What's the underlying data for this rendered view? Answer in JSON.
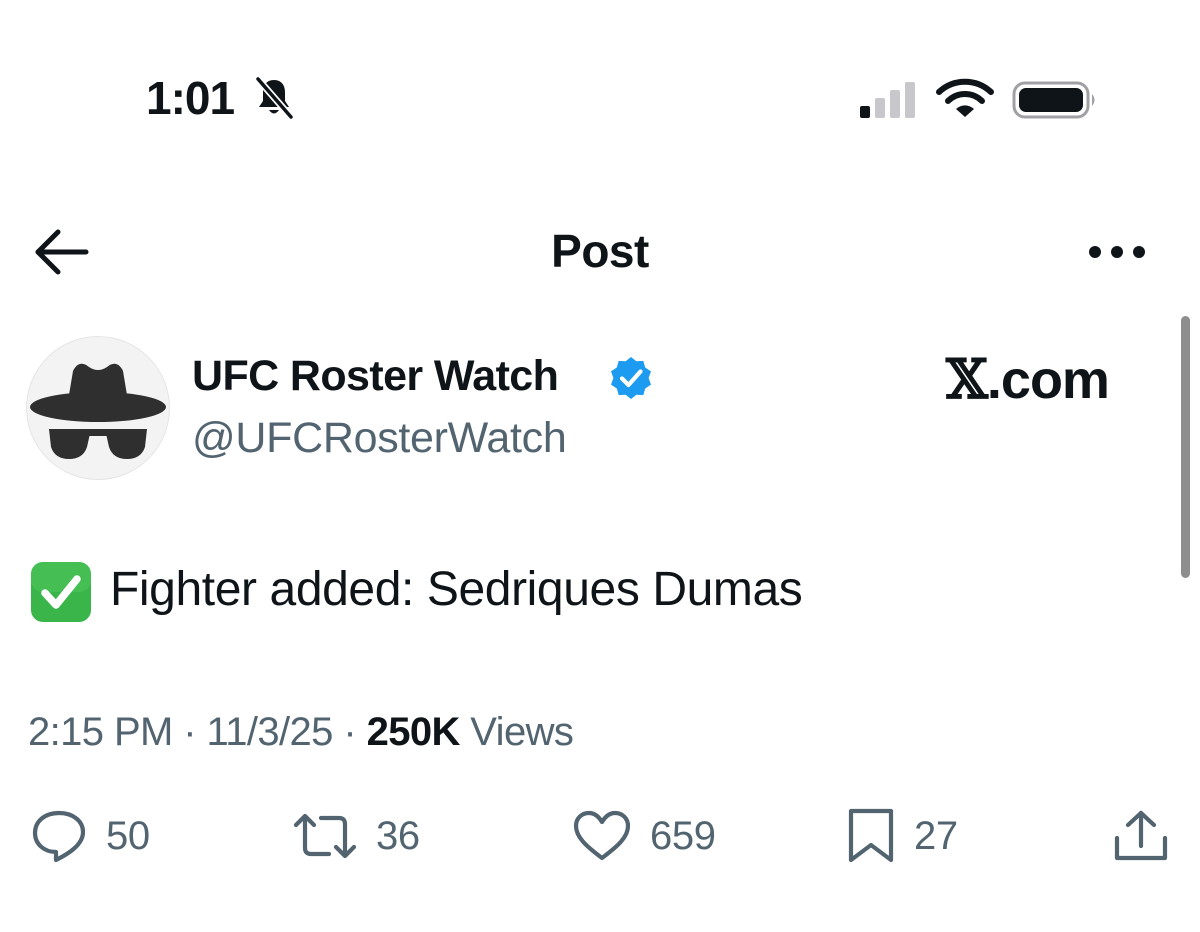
{
  "status_bar": {
    "time": "1:01",
    "icons": [
      "bell-slash-icon",
      "signal-icon",
      "wifi-icon",
      "battery-icon"
    ]
  },
  "header": {
    "title": "Post",
    "back_icon": "arrow-left-icon",
    "more_icon": "more-horizontal-icon"
  },
  "author": {
    "display_name": "UFC Roster Watch",
    "handle": "@UFCRosterWatch",
    "verified": true,
    "avatar_icon": "incognito-hat-glasses-icon"
  },
  "watermark": {
    "x": "𝕏",
    "suffix": ".com"
  },
  "post": {
    "emoji": "check-mark-button-icon",
    "text": "Fighter added: Sedriques Dumas"
  },
  "meta": {
    "time": "2:15 PM",
    "sep1": " · ",
    "date": "11/3/25",
    "sep2": " · ",
    "views_count": "250K",
    "views_label": " Views"
  },
  "actions": {
    "replies": "50",
    "reposts": "36",
    "likes": "659",
    "bookmarks": "27"
  },
  "colors": {
    "text_primary": "#0f1419",
    "text_secondary": "#536471",
    "verified_blue": "#1d9bf0",
    "check_green": "#3ab54a"
  }
}
